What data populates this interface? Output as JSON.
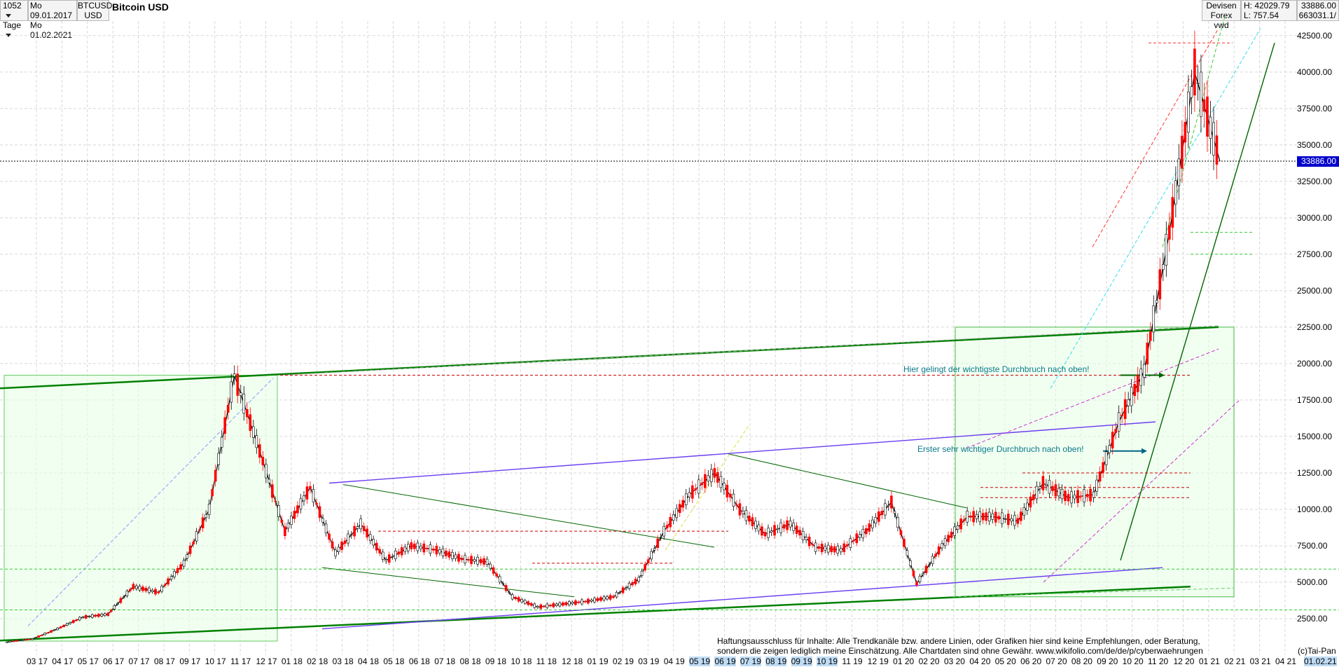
{
  "header": {
    "count": "1052",
    "interval": "Tage",
    "date_start": "Mo 09.01.2017",
    "date_end": "Mo 01.02.2021",
    "symbol": "BTCUSD",
    "currency": "USD",
    "title": "Bitcoin USD",
    "category": "Devisen",
    "source": "Forex vwd",
    "high": "H: 42029.79",
    "low": "L: 757.54",
    "last_price": "33886.00",
    "volume": "663031.1/"
  },
  "colors": {
    "grid": "#d8d8d8",
    "candle_up": "#000000",
    "candle_down": "#ff0000",
    "trend_dark_green": "#008000",
    "green_fill": "#e6ffe6",
    "current_price": "#0000cc",
    "annotation": "#0a7a8a"
  },
  "annotations": [
    "Hier gelingt der wichtigste Durchbruch nach oben!",
    "Erster sehr wichtiger Durchbruch nach oben!"
  ],
  "disclaimer": "Haftungsausschluss für Inhalte: Alle Trendkanäle bzw. andere Linien, oder Grafiken hier sind keine Empfehlungen, oder Beratung, sondern die zeigen lediglich meine Einschätzung. Alle Chartdaten sind ohne Gewähr. www.wikifolio.com/de/de/p/cyberwaehrungen",
  "copyright": "(c)Tai-Pan",
  "chart_data": {
    "type": "line",
    "ylim": [
      0,
      43500
    ],
    "yticks": [
      "42500.00",
      "40000.00",
      "37500.00",
      "35000.00",
      "32500.00",
      "30000.00",
      "27500.00",
      "25000.00",
      "22500.00",
      "20000.00",
      "17500.00",
      "15000.00",
      "12500.00",
      "10000.00",
      "7500.00",
      "5000.00",
      "2500.00"
    ],
    "ytick_values": [
      42500,
      40000,
      37500,
      35000,
      32500,
      30000,
      27500,
      25000,
      22500,
      20000,
      17500,
      15000,
      12500,
      10000,
      7500,
      5000,
      2500
    ],
    "xticks": [
      "03.17",
      "04.17",
      "05.17",
      "06.17",
      "07.17",
      "08.17",
      "09.17",
      "10.17",
      "11.17",
      "12.17",
      "01.18",
      "02.18",
      "03.18",
      "04.18",
      "05.18",
      "06.18",
      "07.18",
      "08.18",
      "09.18",
      "10.18",
      "11.18",
      "12.18",
      "01.19",
      "02.19",
      "03.19",
      "04.19",
      "05.19",
      "06.19",
      "07.19",
      "08.19",
      "09.19",
      "10.19",
      "11.19",
      "12.19",
      "01.20",
      "02.20",
      "03.20",
      "04.20",
      "05.20",
      "06.20",
      "07.20",
      "08.20",
      "09.20",
      "10.20",
      "11.20",
      "12.20",
      "01.21",
      "02.21",
      "03.21",
      "04.21",
      "01.02.21"
    ],
    "x": [
      "2017-01",
      "2017-03",
      "2017-05",
      "2017-07",
      "2017-08",
      "2017-09",
      "2017-10",
      "2017-11",
      "2017-12",
      "2017-12b",
      "2018-01",
      "2018-02",
      "2018-03",
      "2018-04",
      "2018-05",
      "2018-06",
      "2018-07",
      "2018-08",
      "2018-09",
      "2018-10",
      "2018-11",
      "2018-12",
      "2019-01",
      "2019-02",
      "2019-03",
      "2019-04",
      "2019-05",
      "2019-06",
      "2019-07",
      "2019-08",
      "2019-09",
      "2019-10",
      "2019-11",
      "2019-12",
      "2020-01",
      "2020-02",
      "2020-03",
      "2020-04",
      "2020-05",
      "2020-06",
      "2020-07",
      "2020-08",
      "2020-09",
      "2020-10",
      "2020-11",
      "2020-12",
      "2021-01",
      "2021-01b",
      "2021-02"
    ],
    "series": [
      {
        "values": [
          900,
          1100,
          1800,
          2600,
          2800,
          4700,
          4300,
          6300,
          10000,
          19200,
          14000,
          8500,
          11500,
          7000,
          9000,
          6500,
          7500,
          7200,
          6600,
          6400,
          4000,
          3300,
          3500,
          3700,
          4000,
          5200,
          8500,
          11000,
          12500,
          10000,
          8300,
          9000,
          7400,
          7200,
          8500,
          10500,
          4900,
          7500,
          9500,
          9500,
          9200,
          11800,
          10800,
          11000,
          16000,
          19500,
          29000,
          40000,
          33886
        ]
      }
    ]
  }
}
